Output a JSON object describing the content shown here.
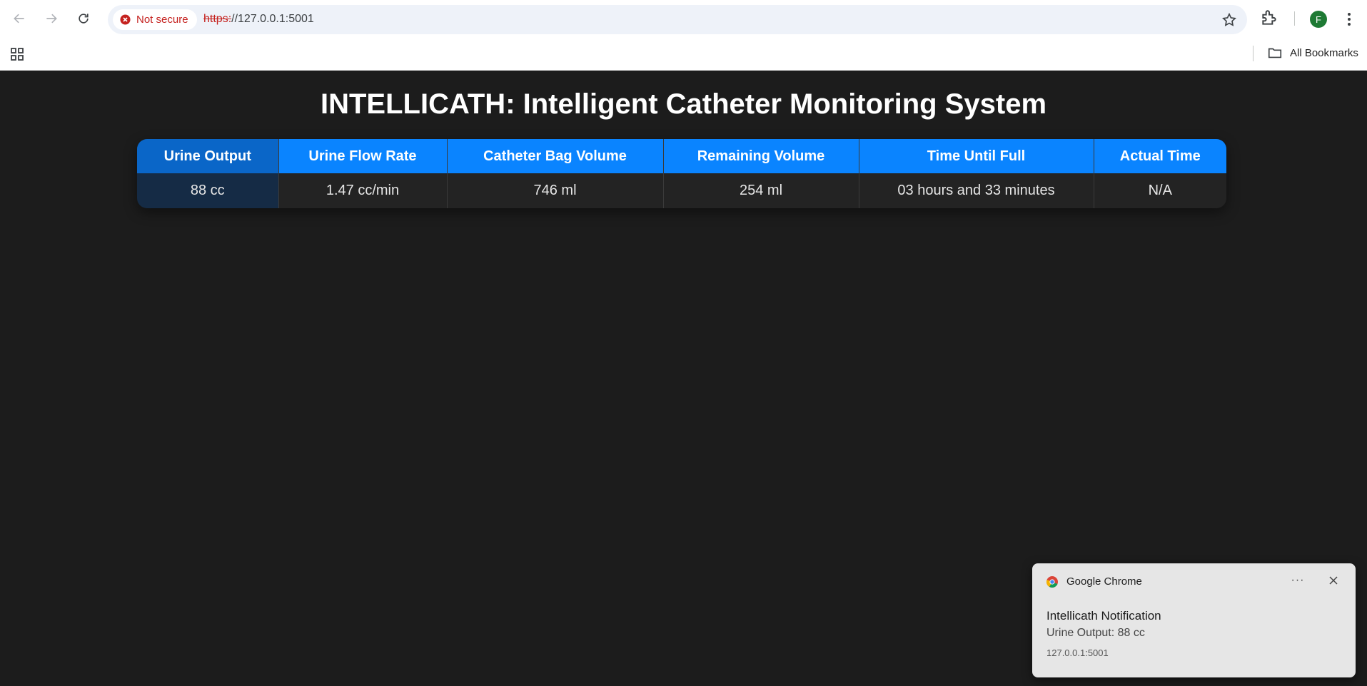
{
  "browser": {
    "security_label": "Not secure",
    "url_protocol": "https:",
    "url_rest": "//127.0.0.1:5001",
    "profile_initial": "F",
    "bookmarks_label": "All Bookmarks",
    "icons": [
      "back-icon",
      "forward-icon",
      "reload-icon",
      "warning-icon",
      "star-icon",
      "extensions-icon",
      "kebab-menu-icon",
      "apps-grid-icon",
      "folder-icon"
    ]
  },
  "page": {
    "title": "INTELLICATH: Intelligent Catheter Monitoring System",
    "table": {
      "headers": [
        "Urine Output",
        "Urine Flow Rate",
        "Catheter Bag Volume",
        "Remaining Volume",
        "Time Until Full",
        "Actual Time"
      ],
      "row": [
        "88 cc",
        "1.47 cc/min",
        "746 ml",
        "254 ml",
        "03 hours and 33 minutes",
        "N/A"
      ]
    },
    "colors": {
      "background": "#1c1c1c",
      "header_blue": "#0a84ff",
      "header_active": "#0a66c8",
      "cell_active": "#152b45"
    }
  },
  "notification": {
    "app_name": "Google Chrome",
    "more_label": "···",
    "title": "Intellicath Notification",
    "body": "Urine Output: 88 cc",
    "origin": "127.0.0.1:5001"
  }
}
